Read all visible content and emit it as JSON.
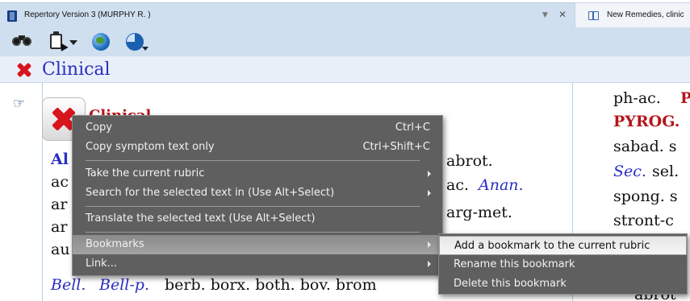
{
  "tabs": {
    "active_title": "Repertory Version 3 (MURPHY R. )",
    "inactive_title": "New Remedies, clinic"
  },
  "toolbar": {
    "icons": [
      "binoculars-icon",
      "clipboard-cursor-icon",
      "globe-icon",
      "pie-chart-icon"
    ]
  },
  "section": {
    "title": "Clinical"
  },
  "content": {
    "box_label": "Clinical",
    "col1": {
      "line1": "Al",
      "line2": "ac",
      "line3": "ar",
      "line4": "ar",
      "line5": "au",
      "line6_a": "Bell.",
      "line6_b": "Bell-p.",
      "line6_c": "berb. borx. both. bov. brom"
    },
    "col2": {
      "line1": "abrot.",
      "line2_a": "ac.",
      "line2_b": "Anan.",
      "line3": "arg-met."
    },
    "col3": {
      "line1_a": "ph-ac.",
      "line1_b": "P",
      "line2": "PYROG.",
      "line3": "sabad. s",
      "line4_a": "Sec.",
      "line4_b": "sel.",
      "line5": "spong. s",
      "line6": "stront-c",
      "line7": "abrot"
    }
  },
  "context_menu": {
    "copy": "Copy",
    "copy_shortcut": "Ctrl+C",
    "copy_symptom": "Copy symptom text only",
    "copy_symptom_shortcut": "Ctrl+Shift+C",
    "take_rubric": "Take the current rubric",
    "search_selected": "Search for the selected text in (Use Alt+Select)",
    "translate": "Translate the selected text (Use Alt+Select)",
    "bookmarks": "Bookmarks",
    "link": "Link..."
  },
  "submenu": {
    "add_bookmark": "Add a bookmark to the current rubric",
    "rename_bookmark": "Rename this bookmark",
    "delete_bookmark": "Delete this bookmark"
  }
}
